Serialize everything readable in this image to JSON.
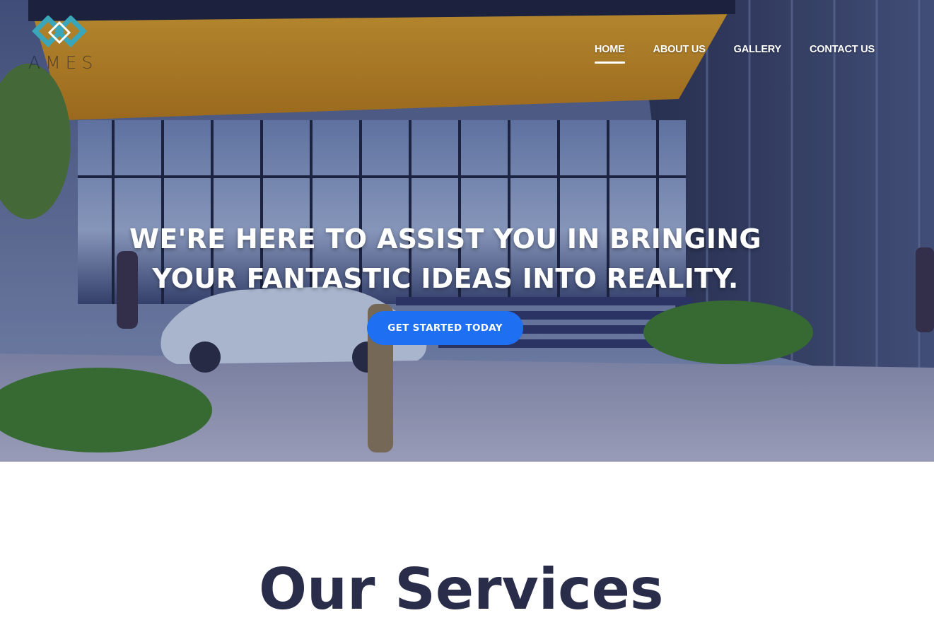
{
  "header": {
    "logo_text": "AMES",
    "nav": [
      {
        "label": "HOME",
        "active": true
      },
      {
        "label": "ABOUT US",
        "active": false
      },
      {
        "label": "GALLERY",
        "active": false
      },
      {
        "label": "CONTACT US",
        "active": false
      }
    ]
  },
  "hero": {
    "headline_line1": "WE'RE HERE TO ASSIST YOU IN BRINGING",
    "headline_line2": "YOUR FANTASTIC IDEAS INTO REALITY.",
    "cta_label": "GET STARTED TODAY",
    "image": "modern-building-entrance-photo"
  },
  "services": {
    "title": "Our Services"
  },
  "colors": {
    "accent": "#1f6ff2",
    "heading_dark": "#2a2d4a",
    "logo_teal": "#3aa6b9"
  }
}
